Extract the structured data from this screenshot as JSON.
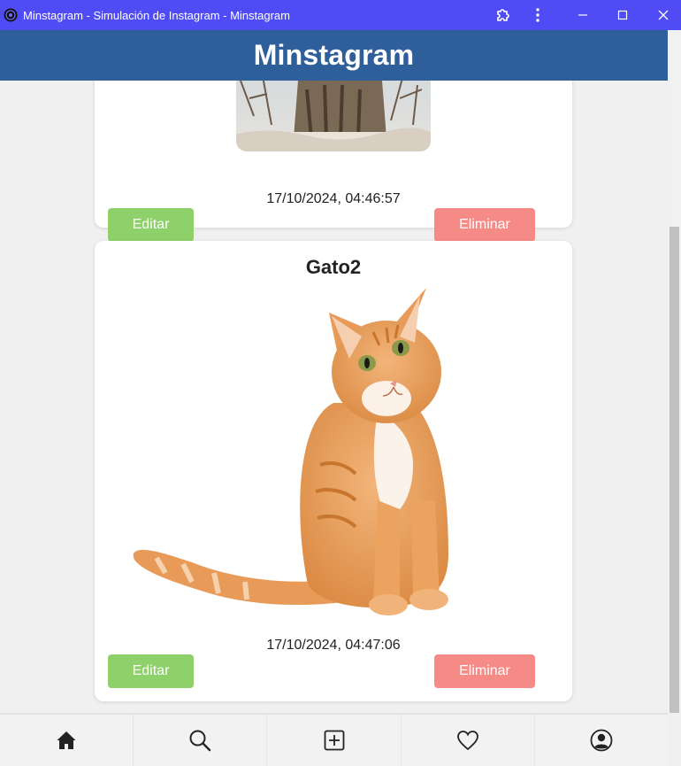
{
  "window": {
    "title": "Minstagram - Simulación de Instagram - Minstagram"
  },
  "header": {
    "brand": "Minstagram"
  },
  "posts": [
    {
      "title": "",
      "date": "17/10/2024, 04:46:57",
      "edit_label": "Editar",
      "delete_label": "Eliminar"
    },
    {
      "title": "Gato2",
      "date": "17/10/2024, 04:47:06",
      "edit_label": "Editar",
      "delete_label": "Eliminar"
    }
  ],
  "nav": {
    "items": [
      "home-icon",
      "search-icon",
      "add-post-icon",
      "heart-icon",
      "profile-icon"
    ]
  },
  "colors": {
    "titlebar": "#4f4cf5",
    "header": "#2f5f9a",
    "edit": "#8ed06a",
    "delete": "#f58a87"
  }
}
